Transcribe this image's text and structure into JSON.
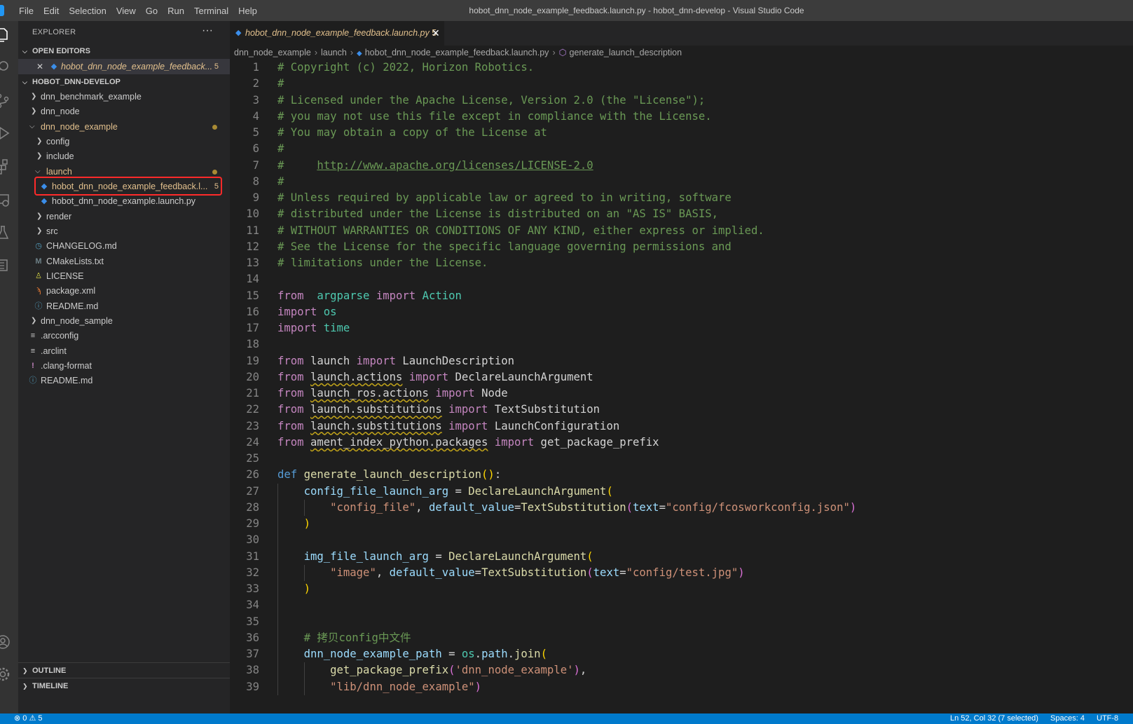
{
  "window": {
    "title": "hobot_dnn_node_example_feedback.launch.py - hobot_dnn-develop - Visual Studio Code",
    "menu": [
      "File",
      "Edit",
      "Selection",
      "View",
      "Go",
      "Run",
      "Terminal",
      "Help"
    ]
  },
  "activity_bar": [
    "explorer-icon",
    "search-icon",
    "source-control-icon",
    "run-debug-icon",
    "extensions-icon",
    "remote-explorer-icon",
    "testing-icon",
    "docker-icon",
    "account-icon",
    "settings-gear-icon"
  ],
  "sidebar": {
    "title": "EXPLORER",
    "more": "···",
    "open_editors": {
      "header": "OPEN EDITORS",
      "items": [
        {
          "name": "hobot_dnn_node_example_feedback...",
          "badge": "5"
        }
      ]
    },
    "workspace": {
      "header": "HOBOT_DNN-DEVELOP",
      "items": [
        {
          "name": "dnn_benchmark_example",
          "kind": "folder"
        },
        {
          "name": "dnn_node",
          "kind": "folder"
        },
        {
          "name": "dnn_node_example",
          "kind": "folder",
          "modified": true
        },
        {
          "name": "config",
          "kind": "folder"
        },
        {
          "name": "include",
          "kind": "folder"
        },
        {
          "name": "launch",
          "kind": "folder",
          "modified": true
        },
        {
          "name": "hobot_dnn_node_example_feedback.l...",
          "kind": "python",
          "badge": "5",
          "modified": true
        },
        {
          "name": "hobot_dnn_node_example.launch.py",
          "kind": "python"
        },
        {
          "name": "render",
          "kind": "folder"
        },
        {
          "name": "src",
          "kind": "folder"
        },
        {
          "name": "CHANGELOG.md",
          "kind": "changelog"
        },
        {
          "name": "CMakeLists.txt",
          "kind": "cmake"
        },
        {
          "name": "LICENSE",
          "kind": "license"
        },
        {
          "name": "package.xml",
          "kind": "xml"
        },
        {
          "name": "README.md",
          "kind": "info"
        },
        {
          "name": "dnn_node_sample",
          "kind": "folder"
        },
        {
          "name": ".arcconfig",
          "kind": "lines"
        },
        {
          "name": ".arclint",
          "kind": "lines"
        },
        {
          "name": ".clang-format",
          "kind": "bang"
        },
        {
          "name": "README.md",
          "kind": "info"
        }
      ]
    },
    "outline": "OUTLINE",
    "timeline": "TIMELINE"
  },
  "editor": {
    "tab": {
      "name": "hobot_dnn_node_example_feedback.launch.py",
      "badge": "5",
      "close": "✕"
    },
    "breadcrumbs": [
      "dnn_node_example",
      "launch",
      "hobot_dnn_node_example_feedback.launch.py",
      "generate_launch_description"
    ],
    "lines": [
      [
        [
          "cm",
          "# Copyright (c) 2022, Horizon Robotics."
        ]
      ],
      [
        [
          "cm",
          "#"
        ]
      ],
      [
        [
          "cm",
          "# Licensed under the Apache License, Version 2.0 (the \"License\");"
        ]
      ],
      [
        [
          "cm",
          "# you may not use this file except in compliance with the License."
        ]
      ],
      [
        [
          "cm",
          "# You may obtain a copy of the License at"
        ]
      ],
      [
        [
          "cm",
          "#"
        ]
      ],
      [
        [
          "cm",
          "#     "
        ],
        [
          "cm lnk",
          "http://www.apache.org/licenses/LICENSE-2.0"
        ]
      ],
      [
        [
          "cm",
          "#"
        ]
      ],
      [
        [
          "cm",
          "# Unless required by applicable law or agreed to in writing, software"
        ]
      ],
      [
        [
          "cm",
          "# distributed under the License is distributed on an \"AS IS\" BASIS,"
        ]
      ],
      [
        [
          "cm",
          "# WITHOUT WARRANTIES OR CONDITIONS OF ANY KIND, either express or implied."
        ]
      ],
      [
        [
          "cm",
          "# See the License for the specific language governing permissions and"
        ]
      ],
      [
        [
          "cm",
          "# limitations under the License."
        ]
      ],
      [],
      [
        [
          "kw",
          "from"
        ],
        [
          "",
          "  "
        ],
        [
          "cls",
          "argparse"
        ],
        [
          "",
          " "
        ],
        [
          "kw",
          "import"
        ],
        [
          "",
          " "
        ],
        [
          "cls",
          "Action"
        ]
      ],
      [
        [
          "kw",
          "import"
        ],
        [
          "",
          " "
        ],
        [
          "cls",
          "os"
        ]
      ],
      [
        [
          "kw",
          "import"
        ],
        [
          "",
          " "
        ],
        [
          "cls",
          "time"
        ]
      ],
      [],
      [
        [
          "kw",
          "from"
        ],
        [
          "",
          " launch "
        ],
        [
          "kw",
          "import"
        ],
        [
          "",
          " LaunchDescription"
        ]
      ],
      [
        [
          "kw",
          "from"
        ],
        [
          "",
          " "
        ],
        [
          "sq",
          "launch.actions"
        ],
        [
          "",
          " "
        ],
        [
          "kw",
          "import"
        ],
        [
          "",
          " DeclareLaunchArgument"
        ]
      ],
      [
        [
          "kw",
          "from"
        ],
        [
          "",
          " "
        ],
        [
          "sq",
          "launch_ros.actions"
        ],
        [
          "",
          " "
        ],
        [
          "kw",
          "import"
        ],
        [
          "",
          " Node"
        ]
      ],
      [
        [
          "kw",
          "from"
        ],
        [
          "",
          " "
        ],
        [
          "sq",
          "launch.substitutions"
        ],
        [
          "",
          " "
        ],
        [
          "kw",
          "import"
        ],
        [
          "",
          " TextSubstitution"
        ]
      ],
      [
        [
          "kw",
          "from"
        ],
        [
          "",
          " "
        ],
        [
          "sq",
          "launch.substitutions"
        ],
        [
          "",
          " "
        ],
        [
          "kw",
          "import"
        ],
        [
          "",
          " LaunchConfiguration"
        ]
      ],
      [
        [
          "kw",
          "from"
        ],
        [
          "",
          " "
        ],
        [
          "sq",
          "ament_index_python.packages"
        ],
        [
          "",
          " "
        ],
        [
          "kw",
          "import"
        ],
        [
          "",
          " get_package_prefix"
        ]
      ],
      [],
      [
        [
          "def",
          "def"
        ],
        [
          "",
          " "
        ],
        [
          "fn",
          "generate_launch_description"
        ],
        [
          "p1",
          "()"
        ],
        [
          "",
          ":"
        ]
      ],
      [
        [
          "",
          "    "
        ],
        [
          "var",
          "config_file_launch_arg"
        ],
        [
          "",
          " = "
        ],
        [
          "fn",
          "DeclareLaunchArgument"
        ],
        [
          "p1",
          "("
        ]
      ],
      [
        [
          "",
          "        "
        ],
        [
          "str",
          "\"config_file\""
        ],
        [
          "",
          ", "
        ],
        [
          "var",
          "default_value"
        ],
        [
          "",
          "="
        ],
        [
          "fn",
          "TextSubstitution"
        ],
        [
          "p2",
          "("
        ],
        [
          "var",
          "text"
        ],
        [
          "",
          "="
        ],
        [
          "str",
          "\"config/fcosworkconfig.json\""
        ],
        [
          "p2",
          ")"
        ]
      ],
      [
        [
          "",
          "    "
        ],
        [
          "p1",
          ")"
        ]
      ],
      [],
      [
        [
          "",
          "    "
        ],
        [
          "var",
          "img_file_launch_arg"
        ],
        [
          "",
          " = "
        ],
        [
          "fn",
          "DeclareLaunchArgument"
        ],
        [
          "p1",
          "("
        ]
      ],
      [
        [
          "",
          "        "
        ],
        [
          "str",
          "\"image\""
        ],
        [
          "",
          ", "
        ],
        [
          "var",
          "default_value"
        ],
        [
          "",
          "="
        ],
        [
          "fn",
          "TextSubstitution"
        ],
        [
          "p2",
          "("
        ],
        [
          "var",
          "text"
        ],
        [
          "",
          "="
        ],
        [
          "str",
          "\"config/test.jpg\""
        ],
        [
          "p2",
          ")"
        ]
      ],
      [
        [
          "",
          "    "
        ],
        [
          "p1",
          ")"
        ]
      ],
      [],
      [],
      [
        [
          "",
          "    "
        ],
        [
          "cm",
          "# 拷贝config中文件"
        ]
      ],
      [
        [
          "",
          "    "
        ],
        [
          "var",
          "dnn_node_example_path"
        ],
        [
          "",
          " = "
        ],
        [
          "cls",
          "os"
        ],
        [
          "",
          "."
        ],
        [
          "var",
          "path"
        ],
        [
          "",
          "."
        ],
        [
          "fn",
          "join"
        ],
        [
          "p1",
          "("
        ]
      ],
      [
        [
          "",
          "        "
        ],
        [
          "fn",
          "get_package_prefix"
        ],
        [
          "p2",
          "("
        ],
        [
          "str",
          "'dnn_node_example'"
        ],
        [
          "p2",
          ")"
        ],
        [
          "",
          ","
        ]
      ],
      [
        [
          "",
          "        "
        ],
        [
          "str",
          "\"lib/dnn_node_example\""
        ],
        [
          "p2",
          ")"
        ]
      ]
    ]
  },
  "statusbar": {
    "problems": "⊗ 0 ⚠ 5",
    "position": "Ln 52, Col 32 (7 selected)",
    "spaces": "Spaces: 4",
    "encoding": "UTF-8"
  }
}
